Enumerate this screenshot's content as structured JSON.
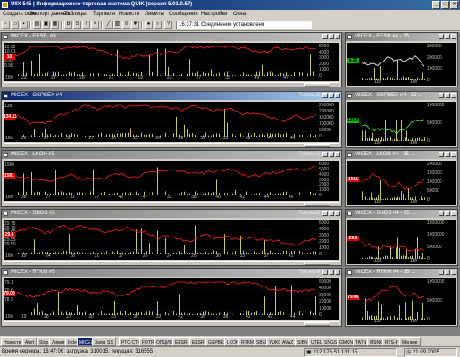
{
  "window": {
    "title": "UIIX 545 | Информационно-торговая система QUIK (версия 5.01.0.57)",
    "controls": {
      "minimize": "_",
      "maximize": "□",
      "close": "×"
    }
  },
  "menu": [
    "Создать окно",
    "Экспорт данных",
    "Таблицы",
    "Торговля",
    "Новости",
    "Лимиты",
    "Сообщения",
    "Настройки",
    "Окна"
  ],
  "toolbar": {
    "connection_status": "16:37:31 Соединение установлено"
  },
  "charts": [
    {
      "title": "MICEX - EESR, #3",
      "active": false,
      "y_labels": [
        "10.02",
        "10.01",
        "10.00",
        "9.99",
        "9.98"
      ],
      "price_tag": "10",
      "vol_labels": [
        "5000",
        "4000",
        "3000",
        "2000",
        "1000",
        "0"
      ],
      "x_labels": [
        "23",
        "19",
        "28",
        "27",
        "19",
        "23",
        "27",
        "35",
        "49",
        "47"
      ],
      "day": "16h"
    },
    {
      "title": "MICEX - GSPBEX #4",
      "active": true,
      "top_label": "Тиковый",
      "y_labels": [
        "138",
        "135"
      ],
      "price_tag": "134.11",
      "price_tag_green": false,
      "vol_labels": [
        "250000",
        "200000",
        "150000",
        "100000",
        "50000",
        "0"
      ],
      "x_labels": [
        "20",
        "27",
        "30",
        "17",
        "20",
        "23",
        "26",
        "29",
        "32",
        "35",
        "38",
        "41",
        "44"
      ],
      "day": "16h"
    },
    {
      "title": "MICEX - LKOH #3",
      "active": false,
      "top_label": "Тиковый",
      "y_labels": [
        "1560"
      ],
      "price_tag": "1561",
      "vol_labels": [
        "6000",
        "5000",
        "4000",
        "3000",
        "2000",
        "1000",
        "0"
      ],
      "x_labels": [
        "38",
        "27",
        "32",
        "37",
        "42",
        "47",
        "32",
        "38",
        "40",
        "42",
        "44",
        "46"
      ],
      "day": "16h"
    },
    {
      "title": "MICEX - SNGS #5",
      "active": false,
      "top_label": "Тиковый",
      "y_labels": [
        "29.75",
        "29.70",
        "29.65",
        "29.60",
        "29.55",
        "29.50"
      ],
      "price_tag": "29.6",
      "vol_labels": [
        "5000",
        "4000",
        "3000",
        "2000",
        "1000",
        "0"
      ],
      "x_labels": [
        "19",
        "24",
        "28",
        "31",
        "17",
        "20",
        "24",
        "26",
        "30",
        "33",
        "37",
        "41"
      ],
      "day": "16h"
    },
    {
      "title": "MICEX - RTKM #5",
      "active": false,
      "top_label": "Тиковый",
      "y_labels": [
        "79.1",
        "79.0",
        "78.9"
      ],
      "price_tag": "79.06",
      "vol_labels": [
        "50000",
        "40000",
        "30000",
        "20000",
        "10000",
        "0"
      ],
      "x_labels": [
        "19",
        "28",
        "27",
        "30",
        "33",
        "36",
        "39",
        "42",
        "36",
        "38",
        "40",
        "42",
        "44"
      ],
      "day": "16h"
    }
  ],
  "minicharts": [
    {
      "title": "MICEX - EESR #4 - 15 ...",
      "price_tag": "9.95",
      "price_green": true,
      "vol_labels": [
        "300000",
        "200000",
        "100000",
        "0"
      ],
      "x_labels": [
        "15h",
        "16h"
      ]
    },
    {
      "title": "MICEX - GSPBEX #4 - 15 ...",
      "price_tag": "135.00",
      "price_green": true,
      "vol_labels": [
        "1000000",
        "500000",
        "0"
      ],
      "x_labels": [
        "15h",
        "16h"
      ]
    },
    {
      "title": "MICEX - LKOH #4 - 15 ...",
      "price_tag": "1561",
      "price_green": false,
      "vol_labels": [
        "200000",
        "150000",
        "100000",
        "50000",
        "0"
      ],
      "x_labels": [
        "15h",
        "16h"
      ]
    },
    {
      "title": "MICEX - SNGS #4 - 15 ...",
      "price_tag": "29.6",
      "price_green": false,
      "vol_labels": [
        "1500000",
        "1000000",
        "500000",
        "0"
      ],
      "x_labels": [
        "15h",
        "16h"
      ]
    },
    {
      "title": "MICEX - RTKM #4 - 15 ...",
      "price_tag": "79.06",
      "price_green": false,
      "vol_labels": [
        "1000000",
        "500000",
        "0"
      ],
      "x_labels": [
        "15h",
        "16h"
      ]
    }
  ],
  "tabs": [
    "Новости",
    "Alert",
    "Stop",
    "Лимиты",
    "Index",
    "MICEX",
    "Заявки",
    "SS",
    "РТС-СТК",
    "FOTRS",
    "ОПЦИОНЫ",
    "EESR",
    "EESRP",
    "GSPBEX",
    "LKOH",
    "RTKM",
    "SBER",
    "YUKO",
    "AVAZ",
    "SIBN",
    "UTEL",
    "SNGS",
    "GMKN",
    "TATN",
    "MSNG",
    "RTS-F",
    "Мелкое"
  ],
  "active_tab": "MICEX",
  "status": {
    "server_time": "Время сервера: 16:47:06; загрузка: 310015; текущая: 316555",
    "server_ip": "212.176.51.131:15",
    "date": "21.09.2005"
  },
  "colors": {
    "price_line": "#ff2020",
    "volume": "#c8c870",
    "mini_price_eesr": "#ffffff",
    "mini_price_gspbex": "#40ff40"
  }
}
